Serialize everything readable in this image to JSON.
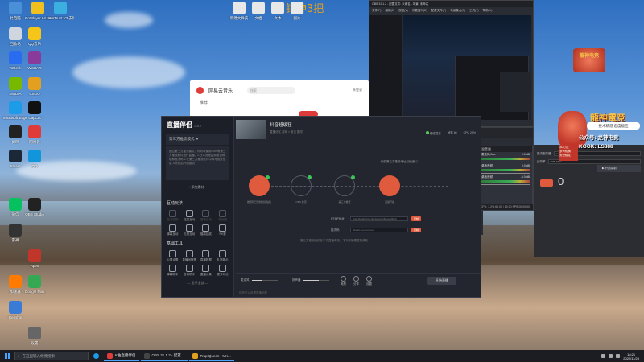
{
  "desktop": {
    "overlay_text": "钻神3把",
    "icons": [
      {
        "label": "此电脑",
        "color": "#4a90d9"
      },
      {
        "label": "PotPlayer 64 bit",
        "color": "#f0c020"
      },
      {
        "label": "VeraTrust V3 去除器",
        "color": "#3bb0e0"
      },
      {
        "label": "回收站",
        "color": "#cfd6df"
      },
      {
        "label": "QQ音乐",
        "color": "#f5c518"
      },
      {
        "label": "ToDesk",
        "color": "#2a6cf0"
      },
      {
        "label": "WinRAR",
        "color": "#8a3a9a"
      },
      {
        "label": "NVIDIA",
        "color": "#76b900"
      },
      {
        "label": "CSGO",
        "color": "#e3a020"
      },
      {
        "label": "Microsoft Edge",
        "color": "#1e9be6"
      },
      {
        "label": "CapCut",
        "color": "#111"
      },
      {
        "label": "剪映",
        "color": "#222"
      },
      {
        "label": "网易云",
        "color": "#e03b3b"
      },
      {
        "label": "Steam",
        "color": "#1b2838"
      },
      {
        "label": "QQ",
        "color": "#1296db"
      },
      {
        "label": "微信",
        "color": "#07c160"
      },
      {
        "label": "OBS Studio",
        "color": "#222"
      },
      {
        "label": "雷神",
        "color": "#333"
      },
      {
        "label": "Apex",
        "color": "#c0362a"
      },
      {
        "label": "加速器",
        "color": "#ff7a00"
      },
      {
        "label": "Google Play",
        "color": "#34a853"
      },
      {
        "label": "Genshin",
        "color": "#3a7bd5"
      },
      {
        "label": "设置",
        "color": "#666"
      }
    ],
    "top_files": [
      {
        "label": "新建文件夹"
      },
      {
        "label": "文档"
      },
      {
        "label": "文本"
      },
      {
        "label": "图片"
      }
    ]
  },
  "music_window": {
    "app_name": "网易云音乐",
    "search_placeholder": "搜索",
    "nav_item": "推荐",
    "login": "未登录"
  },
  "live_window": {
    "brand": "直播伴侣",
    "version": "2.5.2",
    "account": "第三方推流模式 ▼",
    "description": "通过第三方推流模式，你可以使用OBS等第三方推流软件进行直播。1.在本页面复制推流地址和推流码 2.在第三方推流软件中填写相关信息 3.完成后开始推流",
    "add_button": "+ 添加素材",
    "section_interact": "互动玩法",
    "interact_items": [
      {
        "label": "互动礼物",
        "dim": true
      },
      {
        "label": "连麦互动",
        "dim": false
      },
      {
        "label": "语音互动",
        "dim": true
      },
      {
        "label": "粉丝团",
        "dim": true
      },
      {
        "label": "弹幕互动",
        "dim": false
      },
      {
        "label": "礼物互动",
        "dim": false
      },
      {
        "label": "福袋抽奖",
        "dim": false
      },
      {
        "label": "PK赛",
        "dim": false
      }
    ],
    "section_tools": "基础工具",
    "tool_items": [
      {
        "label": "公屏设置"
      },
      {
        "label": "直播间管理"
      },
      {
        "label": "直播数据"
      },
      {
        "label": "礼物展示"
      },
      {
        "label": "弹幕助手"
      },
      {
        "label": "音效助手"
      },
      {
        "label": "直播记录"
      },
      {
        "label": "更多玩法"
      }
    ],
    "more_link": "— 显示全部 —",
    "stream_title": "抖音超级狂",
    "stream_meta": "直播分区  游戏 > 射击  更改",
    "stat_network": "网络稳定",
    "stat_fps": "帧率 60",
    "stat_cpu": "CPU 21%",
    "notice": "你的第三方推流地址已就绪 ⓘ",
    "nodes": [
      {
        "label": "推流码已复制到剪贴板"
      },
      {
        "label": "OBS 推流"
      },
      {
        "label": "第三方推流"
      },
      {
        "label": "直播开播"
      }
    ],
    "rtmp_label": "RTMP地址",
    "rtmp_value": "rtmp://push-rtmp-l11.douyincdn.com/third",
    "key_label": "推流码",
    "key_value": "stream-••••••••••••••••",
    "copy_label": "复制",
    "hint": "第三方推流码仅在本次直播有效，下次开播需重新获取",
    "vol_mic": "麦克风",
    "vol_mic_value": "0.4",
    "vol_speaker": "扬声器",
    "vol_speaker_value": "0.6",
    "ctrl_beauty": "美颜",
    "ctrl_share": "分享",
    "ctrl_settings": "设置",
    "start_button": "开始直播",
    "footnote": "你还可以设置直播回放"
  },
  "obs_back": {
    "title": "OBS 31.1.2 - 配置文件: 未命名 - 场景: 未命名",
    "menu": [
      "文件(F)",
      "编辑(E)",
      "视图(V)",
      "停靠窗口(D)",
      "配置文件(P)",
      "场景集合(S)",
      "工具(T)",
      "帮助(H)"
    ]
  },
  "obs_front": {
    "tab_scene": "场景",
    "tab_settings": "设置",
    "tab_preview": "预览",
    "panel_scenes": "场景",
    "scene_active": "场景",
    "panel_sources": "来源",
    "sources": [
      "心周",
      "摄像头",
      "文本层",
      "显示器",
      "图片",
      "显示器采集"
    ],
    "panel_mixer": "混音器",
    "tracks": [
      {
        "name": "麦克风/Aux",
        "db": "0.0 dB"
      },
      {
        "name": "桌面音频",
        "db": "0.0 dB"
      },
      {
        "name": "桌面音频",
        "db": "-5.0 dB"
      }
    ],
    "status": "CPU: 3.2%  60.00 / 60.00 FPS  00:00:00"
  },
  "obs_lower": {
    "text_prefix": "直播连接",
    "text_state": "最佳化",
    "btn_left": "开始推流",
    "btn_right": "设置"
  },
  "right_panel": {
    "field1_label": "推流服务器",
    "field1_value": "custom",
    "field2_label": "比特率",
    "field2_value": "3000 Kbps",
    "record_button": "▶ 开始录制",
    "counter": "0"
  },
  "ad": {
    "title": "龍神電竞",
    "slogan": "技术精湛  态度极佳",
    "badge_lines": [
      "3D打法",
      "多号轮换",
      "安全稳定"
    ],
    "promo": "公众号: 龙神电竞",
    "kook": "KOOK: LS888",
    "small_title": "龍神电竞"
  },
  "taskbar": {
    "search_placeholder": "在这里输入你要搜索",
    "apps": [
      {
        "label": "K曲直播伴侣",
        "color": "#e03b3b"
      },
      {
        "label": "OBS 31.1.2 - 配置...",
        "color": "#444"
      },
      {
        "label": "Trap Queen - MK...",
        "color": "#e0a020"
      }
    ],
    "time": "18:21",
    "date": "2025/11/25"
  }
}
